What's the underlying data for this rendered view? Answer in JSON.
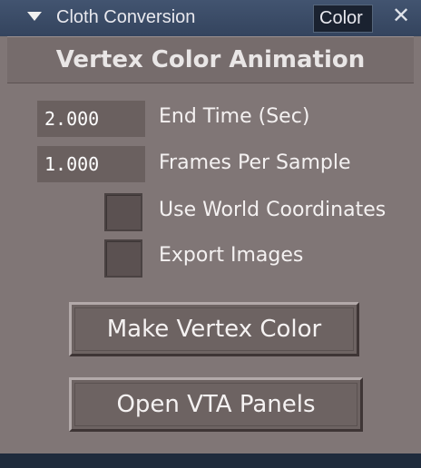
{
  "titlebar": {
    "title": "Cloth Conversion",
    "tab_label": "Color",
    "close_glyph": "✕",
    "collapse_icon": "triangle-down-icon"
  },
  "panel": {
    "heading": "Vertex Color Animation",
    "fields": [
      {
        "value": "2.000",
        "label": "End Time (Sec)"
      },
      {
        "value": "1.000",
        "label": "Frames Per Sample"
      }
    ],
    "checkboxes": [
      {
        "label": "Use World Coordinates",
        "checked": false
      },
      {
        "label": "Export Images",
        "checked": false
      }
    ],
    "buttons": {
      "make_vertex_color": "Make Vertex Color",
      "open_vta_panels": "Open VTA Panels"
    }
  },
  "colors": {
    "panel_bg": "#807676",
    "titlebar_bg": "#3a4a65",
    "field_bg": "#6a605f"
  }
}
